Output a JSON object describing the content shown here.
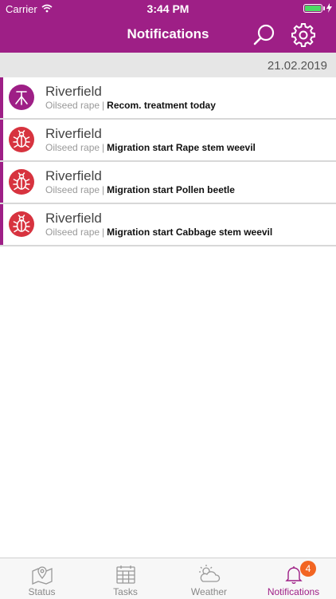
{
  "status_bar": {
    "carrier": "Carrier",
    "time": "3:44 PM"
  },
  "header": {
    "title": "Notifications"
  },
  "date": "21.02.2019",
  "notifications": [
    {
      "title": "Riverfield",
      "crop": "Oilseed rape",
      "separator": "|",
      "message": "Recom. treatment today",
      "icon": "treatment-icon"
    },
    {
      "title": "Riverfield",
      "crop": "Oilseed rape",
      "separator": "|",
      "message": "Migration start Rape stem weevil",
      "icon": "bug-icon"
    },
    {
      "title": "Riverfield",
      "crop": "Oilseed rape",
      "separator": "|",
      "message": "Migration start Pollen beetle",
      "icon": "bug-icon"
    },
    {
      "title": "Riverfield",
      "crop": "Oilseed rape",
      "separator": "|",
      "message": "Migration start Cabbage stem weevil",
      "icon": "bug-icon"
    }
  ],
  "tabs": [
    {
      "label": "Status",
      "icon": "map-pin-icon"
    },
    {
      "label": "Tasks",
      "icon": "calendar-icon"
    },
    {
      "label": "Weather",
      "icon": "weather-icon"
    },
    {
      "label": "Notifications",
      "icon": "bell-icon",
      "badge": "4"
    }
  ],
  "colors": {
    "accent": "#9e1f86",
    "pest": "#d7333f",
    "badge": "#f26522"
  }
}
